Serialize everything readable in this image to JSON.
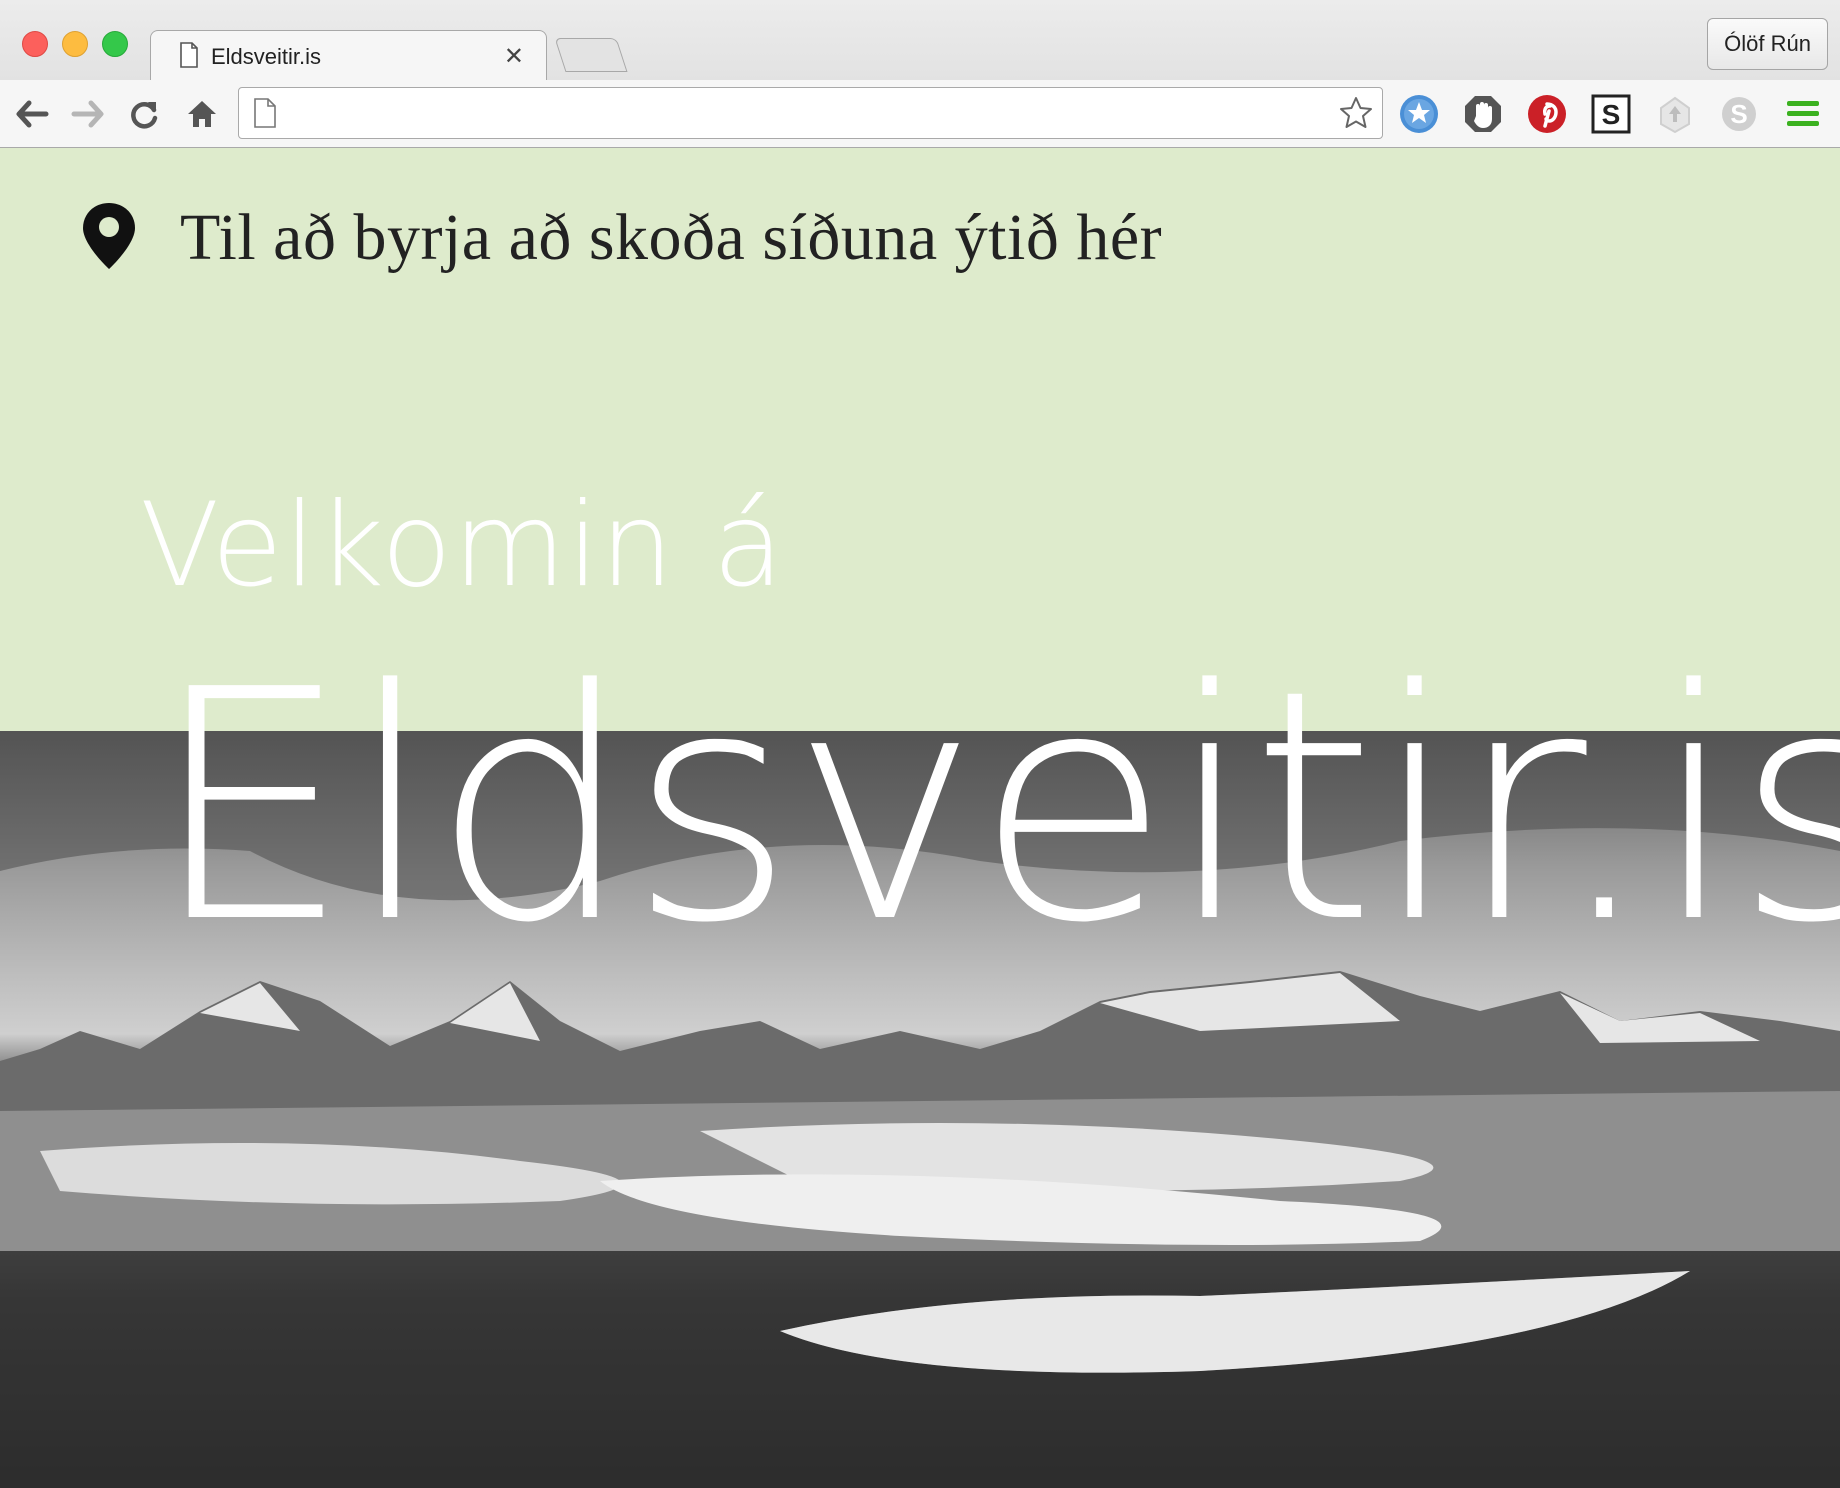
{
  "browser": {
    "tab": {
      "title": "Eldsveitir.is",
      "close_glyph": "✕"
    },
    "profile_label": "Ólöf Rún",
    "address": {
      "value": "",
      "placeholder": ""
    },
    "nav": [
      "back-icon",
      "forward-icon",
      "reload-icon",
      "home-icon"
    ],
    "extensions": [
      "favorites-star-icon",
      "adblock-hand-icon",
      "pinterest-icon",
      "stylish-s-icon",
      "cloud-upload-icon",
      "skype-icon",
      "menu-hamburger-icon"
    ],
    "colors": {
      "pinterest": "#cb2027",
      "extension_blue": "#4a8fd6",
      "menu_green": "#3bb11f"
    }
  },
  "page": {
    "location_prompt": "Til að byrja að skoða síðuna ýtið hér",
    "welcome": "Velkomin á",
    "brand": "Eldsveitir.is",
    "colors": {
      "hero_top": "#deebcc",
      "text_light": "#ffffff"
    }
  }
}
